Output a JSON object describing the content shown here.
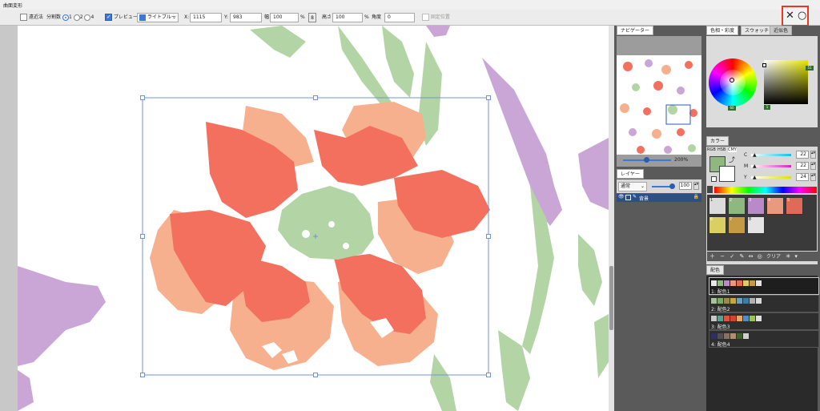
{
  "window": {
    "title": "曲面変形"
  },
  "toolbar": {
    "approx_label": "遠近法",
    "divisions_label": "分割数",
    "div_opts": [
      "1",
      "2",
      "4"
    ],
    "preview_label": "プレビュー",
    "color_label": "ライトブルー",
    "x_label": "X:",
    "x_value": "1115",
    "y_label": "Y:",
    "y_value": "983",
    "width_label": "幅",
    "width_value": "100",
    "pct1": "%",
    "height_label": "高さ",
    "height_value": "100",
    "pct2": "%",
    "angle_label": "角度",
    "angle_value": "0",
    "fixed_label": "固定位置",
    "cancel_glyph": "✕",
    "ok_glyph": "○"
  },
  "navigator": {
    "tab": "ナビゲーター",
    "zoom": "200%"
  },
  "layers": {
    "tab": "レイヤー",
    "blend_mode": "通常",
    "opacity": "100",
    "layer_name": "背景"
  },
  "color_tabs": [
    "色相・彩度",
    "スウォッチ",
    "近似色"
  ],
  "hsv": {
    "h_badge": "60",
    "s_badge": "51",
    "v_badge": "1"
  },
  "color_panel": {
    "title": "カラー",
    "modes": [
      "RGB",
      "HSB",
      "CMY"
    ],
    "channels": [
      {
        "name": "C",
        "value": "22"
      },
      {
        "name": "M",
        "value": "22"
      },
      {
        "name": "Y",
        "value": "24"
      }
    ],
    "palette": [
      {
        "n": "1",
        "color": "#dcdcdc"
      },
      {
        "n": "2",
        "color": "#8fb880"
      },
      {
        "n": "3",
        "color": "#b98ac8"
      },
      {
        "n": "4",
        "color": "#e89a7e"
      },
      {
        "n": "5",
        "color": "#e06a58"
      },
      {
        "n": "6",
        "color": "#d9cf62"
      },
      {
        "n": "7",
        "color": "#c59a45"
      },
      {
        "n": "8",
        "color": "#e4e4e4"
      }
    ],
    "clear_label": "クリア"
  },
  "color_sets": {
    "title": "配色",
    "rows": [
      {
        "label": "1: 配色1",
        "colors": [
          "#e8e8e8",
          "#8fb880",
          "#b98ac8",
          "#e89a7e",
          "#e06a58",
          "#d9cf62",
          "#c59a45",
          "#e4e4e4"
        ]
      },
      {
        "label": "2: 配色2",
        "colors": [
          "#a7c59a",
          "#7fa86e",
          "#9b8a4e",
          "#c7a743",
          "#6aa0b8",
          "#3a7fa0",
          "#b0b0b0",
          "#d8d8d8"
        ]
      },
      {
        "label": "3: 配色3",
        "colors": [
          "#c8c8c8",
          "#5f9e8f",
          "#d9553e",
          "#c8483a",
          "#e7a76a",
          "#4a90c0",
          "#a0c060",
          "#e0e0e0"
        ]
      },
      {
        "label": "4: 配色4",
        "colors": [
          "#303060",
          "#505050",
          "#8a7060",
          "#b09070",
          "#406030",
          "#d0d0d0"
        ]
      }
    ]
  },
  "colors": {
    "selection": "#e83820",
    "canvas_green": "#b3d5a5",
    "canvas_purple": "#c9a6d6",
    "canvas_red": "#f4705e",
    "canvas_peach": "#f7b08e"
  }
}
